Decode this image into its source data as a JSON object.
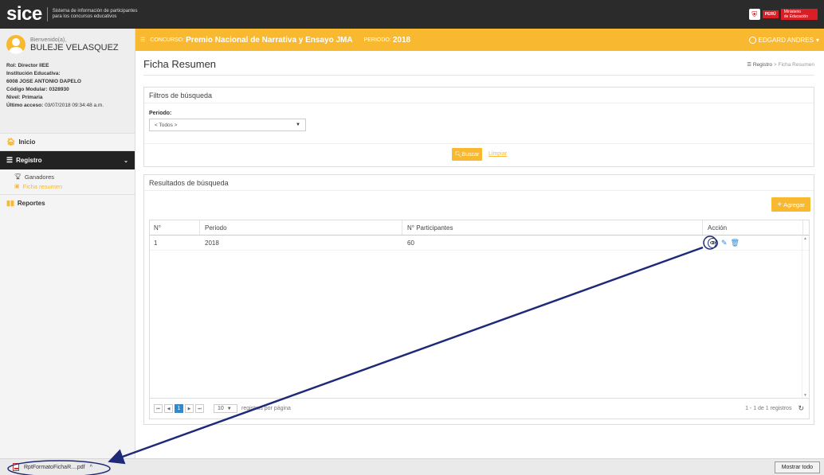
{
  "header": {
    "logo": "sice",
    "subtitle_line1": "Sistema de información de participantes",
    "subtitle_line2": "para los concursos educativos",
    "peru_label": "PERÚ",
    "minedu_line1": "Ministerio",
    "minedu_line2": "de Educación"
  },
  "sidebar": {
    "welcome": "Bienvenido(a),",
    "user_name": "BULEJE VELASQUEZ",
    "rol_label": "Rol:",
    "rol_value": "Director IIEE",
    "inst_label": "Institución Educativa:",
    "inst_value": "6008 JOSE ANTONIO DAPELO",
    "cod_label": "Código Modular:",
    "cod_value": "0328930",
    "nivel_label": "Nivel:",
    "nivel_value": "Primaria",
    "acceso_label": "Último acceso:",
    "acceso_value": "03/07/2018 09:34:48 a.m.",
    "nav_inicio": "Inicio",
    "nav_registro": "Registro",
    "sub_ganadores": "Ganadores",
    "sub_ficha": "Ficha resumen",
    "nav_reportes": "Reportes"
  },
  "topbar": {
    "concurso_label": "CONCURSO:",
    "concurso_value": "Premio Nacional de Narrativa y Ensayo JMA",
    "periodo_label": "PERIODO:",
    "periodo_value": "2018",
    "user": "EDGARD ANDRES"
  },
  "main": {
    "title": "Ficha Resumen",
    "breadcrumb_root": "Registro",
    "breadcrumb_sep": ">",
    "breadcrumb_current": "Ficha Resumen",
    "filters_title": "Filtros de búsqueda",
    "periodo_field_label": "Periodo:",
    "periodo_selected": "< Todos >",
    "buscar": "Buscar",
    "limpiar": "Limpiar",
    "results_title": "Resultados de búsqueda",
    "agregar": "Agregar",
    "columns": [
      "N°",
      "Periodo",
      "N° Participantes",
      "Acción"
    ],
    "rows": [
      {
        "n": "1",
        "periodo": "2018",
        "participantes": "60"
      }
    ],
    "current_page": "1",
    "page_size": "10",
    "page_size_label": "registros por página",
    "count": "1 - 1 de 1 registros"
  },
  "downloads": {
    "file": "RptFormatoFichaR....pdf",
    "mostrar_todo": "Mostrar todo"
  },
  "colors": {
    "accent": "#f8b830",
    "topbar": "#2b2b2b",
    "link_blue": "#2f8ad0",
    "annotation": "#1e2a78"
  }
}
